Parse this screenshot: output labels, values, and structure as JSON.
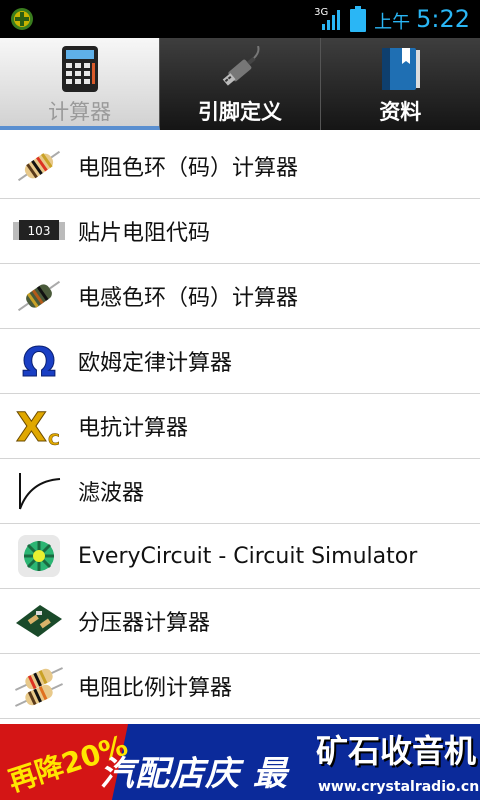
{
  "status_bar": {
    "network_label": "3G",
    "ampm": "上午",
    "time": "5:22"
  },
  "tabs": [
    {
      "label": "计算器",
      "icon": "calculator-icon",
      "selected": true
    },
    {
      "label": "引脚定义",
      "icon": "usb-plug-icon",
      "selected": false
    },
    {
      "label": "资料",
      "icon": "book-icon",
      "selected": false
    }
  ],
  "list": [
    {
      "label": "电阻色环（码）计算器",
      "icon": "resistor-icon"
    },
    {
      "label": "贴片电阻代码",
      "icon": "smd-resistor-103-icon",
      "icon_text": "103"
    },
    {
      "label": "电感色环（码）计算器",
      "icon": "inductor-icon"
    },
    {
      "label": "欧姆定律计算器",
      "icon": "ohm-symbol-icon",
      "icon_text": "Ω"
    },
    {
      "label": "电抗计算器",
      "icon": "reactance-xc-icon",
      "icon_text": "X",
      "icon_sub": "C"
    },
    {
      "label": "滤波器",
      "icon": "filter-curve-icon"
    },
    {
      "label": "EveryCircuit - Circuit Simulator",
      "icon": "everycircuit-icon"
    },
    {
      "label": "分压器计算器",
      "icon": "circuit-board-icon"
    },
    {
      "label": "电阻比例计算器",
      "icon": "resistor-pair-icon"
    }
  ],
  "ad": {
    "text1": "再降20%",
    "text2": "汽配店庆 最",
    "text3": "矿石收音机",
    "url": "www.crystalradio.cn"
  },
  "colors": {
    "clock": "#2ab6f5",
    "ad_background": "#0b2a9a",
    "ad_red": "#d41515",
    "tab_active_indicator": "#5a8fd0"
  }
}
